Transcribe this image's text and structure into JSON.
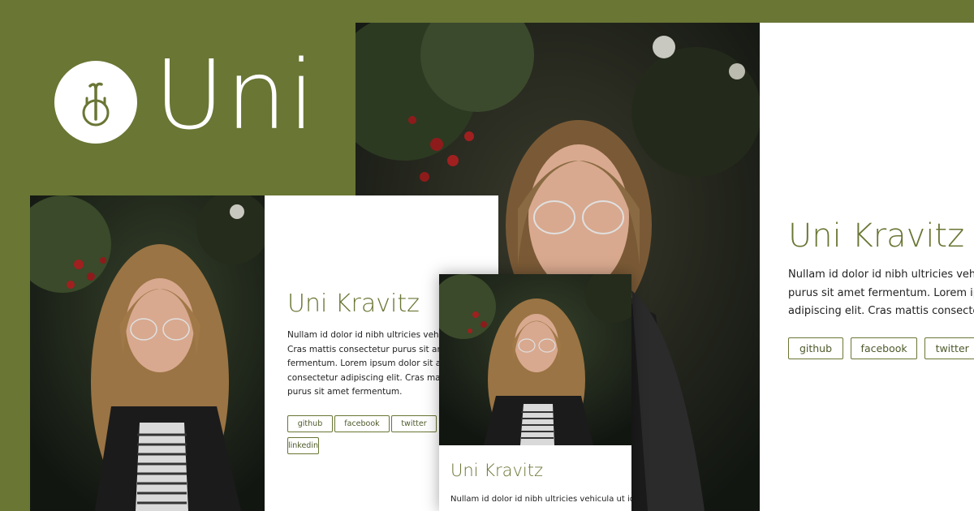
{
  "brand": {
    "name": "Uni",
    "icon": "unicycle-icon",
    "colors": {
      "accent": "#697634",
      "card": "#ffffff",
      "text": "#222222"
    }
  },
  "profile": {
    "name": "Uni Kravitz",
    "photo": "portrait-photo",
    "buttons": [
      "github",
      "facebook",
      "twitter",
      "linkedin"
    ]
  },
  "large": {
    "bio": "Nullam id dolor id nibh ultricies vehicula\npurus sit amet fermentum. Lorem ipsum\nadipiscing elit. Cras mattis consectetur p"
  },
  "medium": {
    "bio": "Nullam id dolor id nibh ultricies vehicula\nCras mattis consectetur purus sit amet\nfermentum. Lorem ipsum dolor sit amet,\nconsectetur adipiscing elit. Cras mattis co\npurus sit amet fermentum."
  },
  "small": {
    "bio": "Nullam id dolor id nibh ultricies vehicula ut id"
  }
}
